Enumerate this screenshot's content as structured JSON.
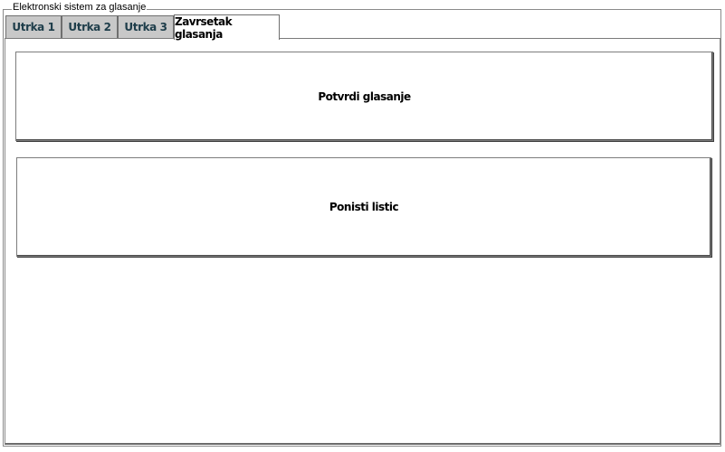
{
  "groupbox": {
    "title": "Elektronski sistem za glasanje"
  },
  "tabs": [
    {
      "label": "Utrka 1",
      "active": false
    },
    {
      "label": "Utrka 2",
      "active": false
    },
    {
      "label": "Utrka 3",
      "active": false
    },
    {
      "label": "Zavrsetak glasanja",
      "active": true
    }
  ],
  "panel": {
    "confirm_label": "Potvrdi glasanje",
    "cancel_label": "Ponisti listic"
  }
}
